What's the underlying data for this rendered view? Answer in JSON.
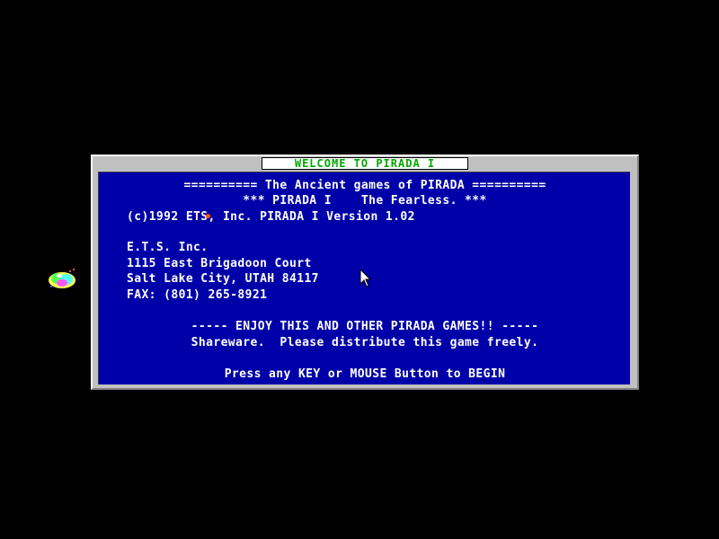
{
  "window": {
    "title": "WELCOME TO PIRADA I"
  },
  "panel": {
    "header_line": "========== The Ancient games of PIRADA ==========",
    "subtitle_line": "*** PIRADA I    The Fearless. ***",
    "copyright_line": "(c)1992 ETS, Inc. PIRADA I Version 1.02",
    "address": {
      "company": "E.T.S. Inc.",
      "street": "1115 East Brigadoon Court",
      "city": "Salt Lake City, UTAH 84117",
      "fax": "FAX: (801) 265-8921"
    },
    "enjoy_line": "----- ENJOY THIS AND OTHER PIRADA GAMES!! -----",
    "shareware_line": "Shareware.  Please distribute this game freely.",
    "prompt_line": "Press any KEY or MOUSE Button to BEGIN"
  },
  "colors": {
    "background": "#000000",
    "panel": "#0000a8",
    "frame": "#c0c0c0",
    "title_text": "#00a800",
    "text": "#ffffff"
  },
  "icons": {
    "cursor": "mouse-pointer-icon",
    "balloon": "balloon-sprite-icon"
  }
}
